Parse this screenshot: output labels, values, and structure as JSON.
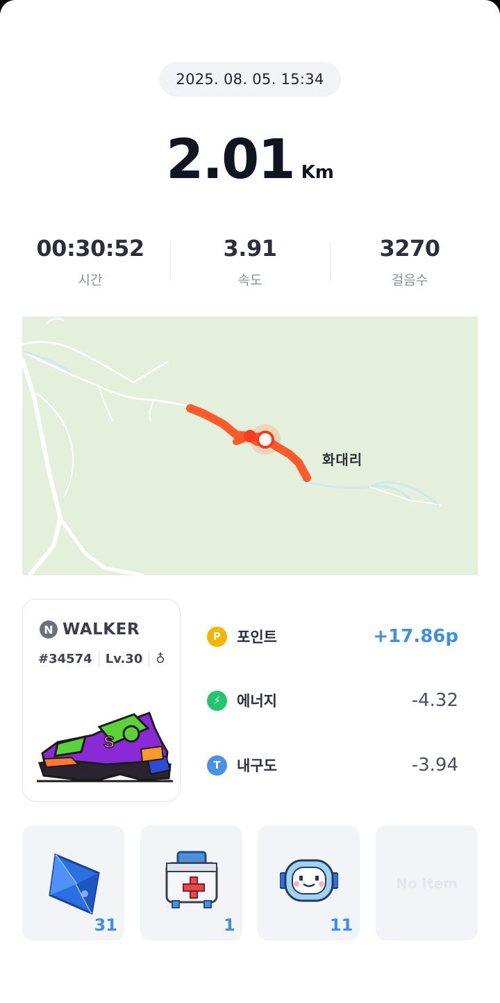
{
  "record": {
    "datetime": "2025. 08. 05. 15:34",
    "distance": "2.01",
    "distance_unit": "Km"
  },
  "stats": [
    {
      "value": "00:30:52",
      "label": "시간"
    },
    {
      "value": "3.91",
      "label": "속도"
    },
    {
      "value": "3270",
      "label": "걸음수"
    }
  ],
  "map": {
    "place_label": "화대리"
  },
  "nft": {
    "logo_letter": "N",
    "name": "WALKER",
    "token_id": "#34574",
    "level": "Lv.30",
    "glyph": "♁"
  },
  "rewards": [
    {
      "icon": "P",
      "icon_color": "#f5b400",
      "label": "포인트",
      "value": "+17.86p",
      "positive": true
    },
    {
      "icon": "⚡",
      "icon_color": "#27c46e",
      "label": "에너지",
      "value": "-4.32",
      "positive": false
    },
    {
      "icon": "T",
      "icon_color": "#4a90e8",
      "label": "내구도",
      "value": "-3.94",
      "positive": false
    }
  ],
  "items": [
    {
      "icon": "blue-crystal-icon",
      "count": "31"
    },
    {
      "icon": "first-aid-kit-icon",
      "count": "1"
    },
    {
      "icon": "robot-face-icon",
      "count": "11"
    },
    {
      "empty_label": "No Item"
    }
  ],
  "colors": {
    "accent_blue": "#3d8fe8",
    "route_orange": "#ff5a2b",
    "map_bg": "#e4f0dc"
  }
}
